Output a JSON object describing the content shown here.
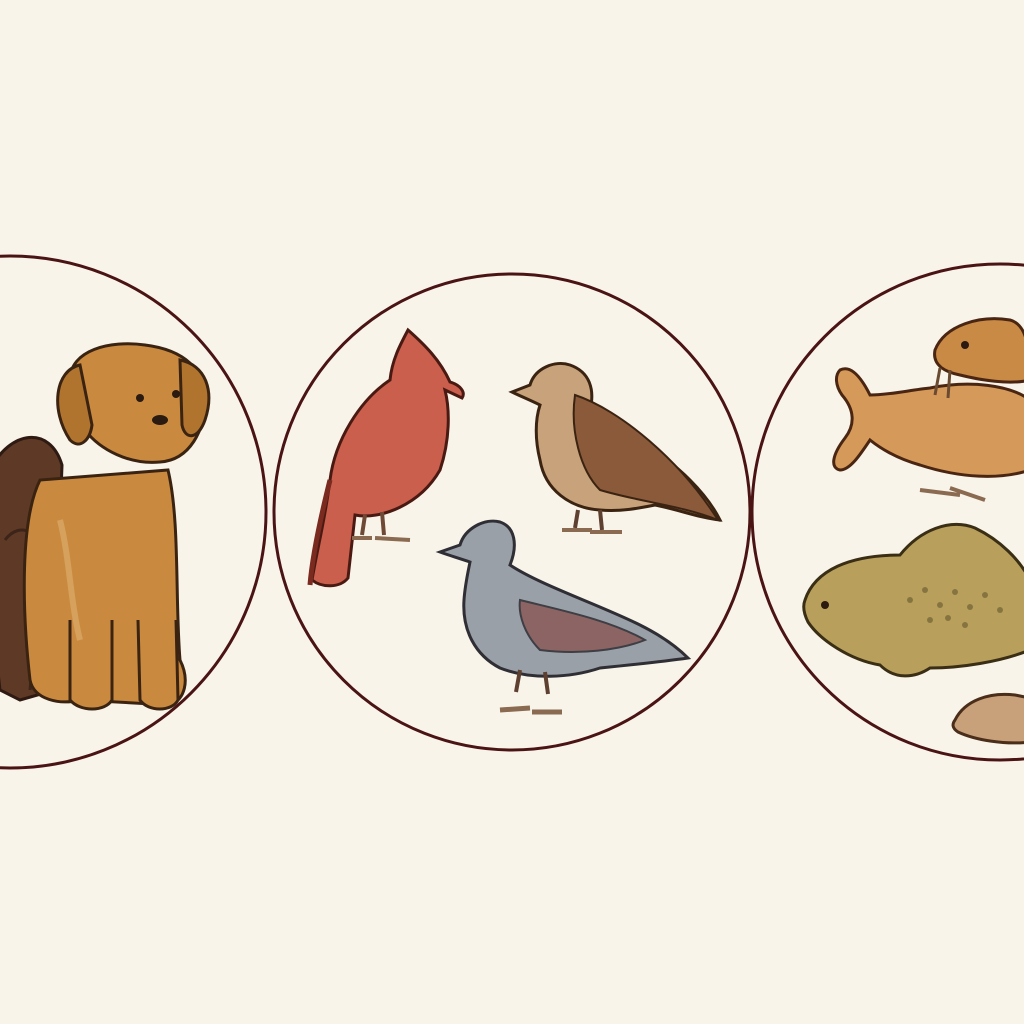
{
  "colors": {
    "background": "#f8f4ea",
    "circle_outline": "#4a1414",
    "dog_brown": "#c98a3f",
    "dog_dark": "#5e3a26",
    "bird_red": "#c95f4c",
    "bird_tan": "#b4875c",
    "bird_gray": "#9aa0a8",
    "fish_orange": "#d59a5a",
    "seal_olive": "#b8a05c"
  },
  "panels": [
    {
      "subject": "dogs",
      "items": [
        "dark-brown-dog-icon",
        "golden-dog-icon"
      ]
    },
    {
      "subject": "birds",
      "items": [
        "red-bird-icon",
        "tan-bird-icon",
        "gray-pigeon-icon"
      ]
    },
    {
      "subject": "sea-creatures",
      "items": [
        "orange-fish-icon",
        "walrus-icon",
        "olive-sea-creature-icon",
        "small-seal-icon"
      ]
    }
  ]
}
